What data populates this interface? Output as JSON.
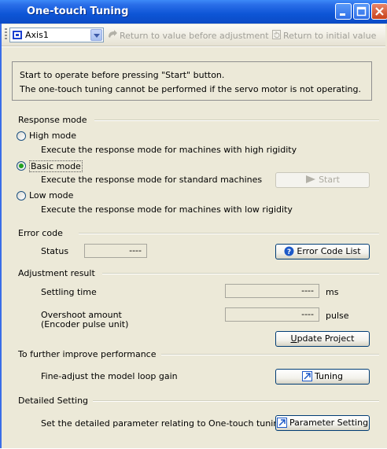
{
  "window": {
    "title": "One-touch Tuning"
  },
  "toolbar": {
    "axis_value": "Axis1",
    "return_before_label": "Return to value before adjustment",
    "return_initial_label": "Return to initial value"
  },
  "info": {
    "line1": "Start to operate before pressing \"Start\" button.",
    "line2": "The one-touch tuning cannot be performed if the servo motor is not operating."
  },
  "response_mode": {
    "title": "Response mode",
    "options": [
      {
        "label": "High mode",
        "desc": "Execute the response mode for machines with high rigidity",
        "selected": false
      },
      {
        "label": "Basic mode",
        "desc": "Execute the response mode for standard machines",
        "selected": true
      },
      {
        "label": "Low mode",
        "desc": "Execute the response mode for machines with low rigidity",
        "selected": false
      }
    ],
    "start_label": "Start"
  },
  "error_code": {
    "title": "Error code",
    "status_label": "Status",
    "status_value": "----",
    "list_button": "Error Code List"
  },
  "adjustment": {
    "title": "Adjustment result",
    "settling_label": "Settling time",
    "settling_value": "----",
    "settling_unit": "ms",
    "overshoot_label": "Overshoot amount",
    "overshoot_sub": "(Encoder pulse unit)",
    "overshoot_value": "----",
    "overshoot_unit": "pulse",
    "update_button_u": "U",
    "update_button_rest": "pdate Project"
  },
  "improve": {
    "title": "To further improve performance",
    "desc": "Fine-adjust the model loop gain",
    "button": "Tuning"
  },
  "detailed": {
    "title": "Detailed Setting",
    "desc": "Set the detailed parameter relating to One-touch tuning",
    "button": "Parameter Setting"
  },
  "colors": {
    "titlebar": "#0b4bc6",
    "panel": "#ece9d8",
    "radio_checked": "#21a121"
  }
}
